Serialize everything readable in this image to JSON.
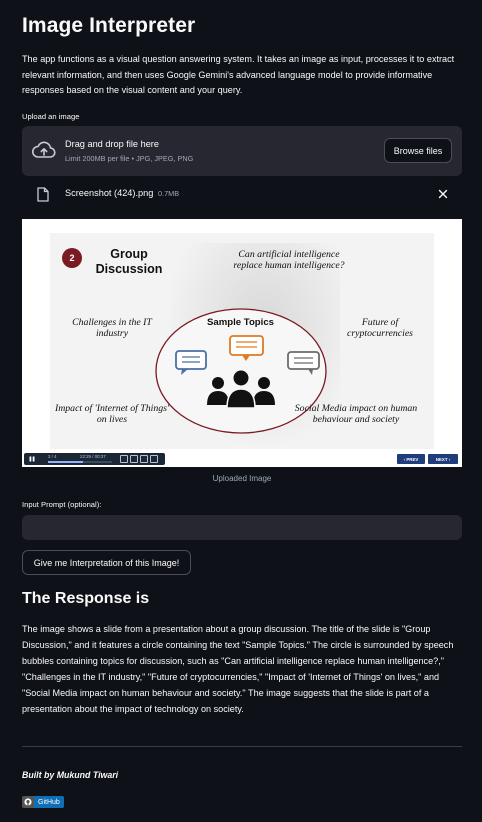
{
  "header": {
    "title": "Image Interpreter",
    "intro": "The app functions as a visual question answering system. It takes an image as input, processes it to extract relevant information, and then uses Google Gemini's advanced language model to provide informative responses based on the visual content and your query."
  },
  "upload": {
    "label": "Upload an image",
    "dropzone_title": "Drag and drop file here",
    "dropzone_subtitle": "Limit 200MB per file • JPG, JPEG, PNG",
    "browse_label": "Browse files",
    "file_name": "Screenshot (424).png",
    "file_size": "0.7MB",
    "icons": {
      "cloud": "cloud-upload-icon",
      "file": "file-icon",
      "remove": "close-icon"
    }
  },
  "slide": {
    "number": "2",
    "heading_line1": "Group",
    "heading_line2": "Discussion",
    "center_label": "Sample Topics",
    "topics": {
      "ai": "Can artificial intelligence replace human intelligence?",
      "it": "Challenges in the IT industry",
      "crypto": "Future of cryptocurrencies",
      "iot": "Impact of 'Internet of Things' on lives",
      "social": "Social Media impact on human behaviour and society"
    },
    "player": {
      "counter": "2 / 4",
      "time": "22:29 / 00:37",
      "progress": 0.55,
      "prev_label": "‹ PREV",
      "next_label": "NEXT ›"
    },
    "accent": "#7a1a22"
  },
  "image_caption": "Uploaded Image",
  "prompt": {
    "label": "Input Prompt (optional):",
    "value": "",
    "placeholder": ""
  },
  "action": {
    "button_label": "Give me Interpretation of this Image!"
  },
  "response": {
    "heading": "The Response is",
    "text": "The image shows a slide from a presentation about a group discussion. The title of the slide is \"Group Discussion,\" and it features a circle containing the text \"Sample Topics.\" The circle is surrounded by speech bubbles containing topics for discussion, such as \"Can artificial intelligence replace human intelligence?,\" \"Challenges in the IT industry,\" \"Future of cryptocurrencies,\" \"Impact of 'Internet of Things' on lives,\" and \"Social Media impact on human behaviour and society.\" The image suggests that the slide is part of a presentation about the impact of technology on society."
  },
  "footer": {
    "credit": "Built by Mukund Tiwari",
    "badge_label": "GitHub",
    "badge_icon": "github-icon"
  },
  "colors": {
    "background": "#0e1117",
    "surface": "#262730",
    "text": "#fafafa",
    "muted": "#a3a8b4",
    "badge": "#0f6fb6"
  }
}
